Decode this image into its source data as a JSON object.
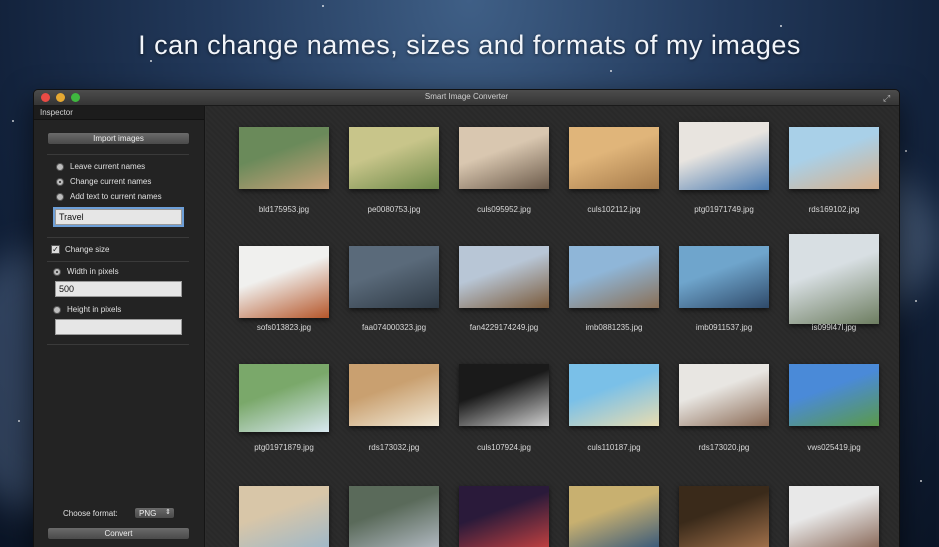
{
  "headline": "I can change names, sizes and formats of my images",
  "window": {
    "title": "Smart Image Converter"
  },
  "inspector": {
    "header": "Inspector",
    "import_label": "Import images",
    "naming": {
      "options": [
        "Leave current names",
        "Change current names",
        "Add text to current names"
      ],
      "selected": 1,
      "text_value": "Travel"
    },
    "resize": {
      "checkbox_label": "Change size",
      "checked": true,
      "width_label": "Width in pixels",
      "width_value": "500",
      "height_label": "Height in pixels",
      "height_value": ""
    },
    "format_label": "Choose format:",
    "format_value": "PNG",
    "convert_label": "Convert"
  },
  "images": [
    {
      "name": "bld175953.jpg",
      "c1": "#6a8a5a",
      "c2": "#c9a27a"
    },
    {
      "name": "pe0080753.jpg",
      "c1": "#c8c58a",
      "c2": "#6f8a4a"
    },
    {
      "name": "culs095952.jpg",
      "c1": "#d9c7b0",
      "c2": "#6b5a4a"
    },
    {
      "name": "culs102112.jpg",
      "c1": "#e0b57a",
      "c2": "#a57a4a"
    },
    {
      "name": "ptg01971749.jpg",
      "c1": "#e8e4df",
      "c2": "#4a7ab0"
    },
    {
      "name": "rds169102.jpg",
      "c1": "#a9d0e8",
      "c2": "#d8b08a"
    },
    {
      "name": "sofs013823.jpg",
      "c1": "#f0f0ee",
      "c2": "#b5562a"
    },
    {
      "name": "faa074000323.jpg",
      "c1": "#5a6a7a",
      "c2": "#2f3a45"
    },
    {
      "name": "fan4229174249.jpg",
      "c1": "#b8c6d6",
      "c2": "#7a5a3a"
    },
    {
      "name": "imb0881235.jpg",
      "c1": "#8fb6d8",
      "c2": "#8a6f55"
    },
    {
      "name": "imb0911537.jpg",
      "c1": "#6fa5cc",
      "c2": "#2f4a6a"
    },
    {
      "name": "is099l47l.jpg",
      "c1": "#d8dfe3",
      "c2": "#6d7d60"
    },
    {
      "name": "ptg01971879.jpg",
      "c1": "#7aa86a",
      "c2": "#d8e8f0"
    },
    {
      "name": "rds173032.jpg",
      "c1": "#c9a070",
      "c2": "#f2ead8"
    },
    {
      "name": "culs107924.jpg",
      "c1": "#1a1a1a",
      "c2": "#cfcfcf"
    },
    {
      "name": "culs110187.jpg",
      "c1": "#7ac0e8",
      "c2": "#e8dcb0"
    },
    {
      "name": "rds173020.jpg",
      "c1": "#e8e6e2",
      "c2": "#8a6a55"
    },
    {
      "name": "vws025419.jpg",
      "c1": "#4a8ad8",
      "c2": "#5a9a4a"
    },
    {
      "name": "",
      "c1": "#d8c6a8",
      "c2": "#9fb8c8"
    },
    {
      "name": "",
      "c1": "#5a6a5a",
      "c2": "#b0b8c0"
    },
    {
      "name": "",
      "c1": "#2a1a3a",
      "c2": "#c04040"
    },
    {
      "name": "",
      "c1": "#c8b070",
      "c2": "#3a5a7a"
    },
    {
      "name": "",
      "c1": "#3a2a1a",
      "c2": "#a0704a"
    },
    {
      "name": "",
      "c1": "#e8e8e8",
      "c2": "#8a6a5a"
    }
  ]
}
